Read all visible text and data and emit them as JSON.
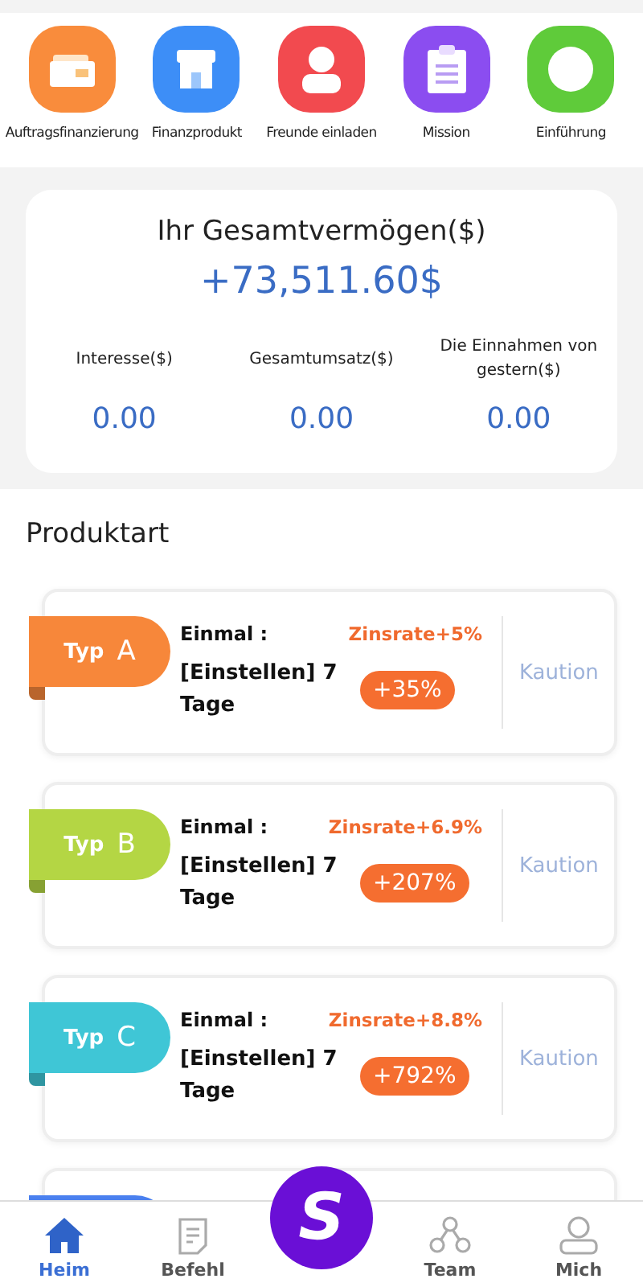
{
  "shortcuts": [
    {
      "label": "Auftragsfinanzierung",
      "color": "#f98c3c",
      "kind": "wallet"
    },
    {
      "label": "Finanzprodukt",
      "color": "#3d8ef7",
      "kind": "shop"
    },
    {
      "label": "Freunde einladen",
      "color": "#f24a4f",
      "kind": "person"
    },
    {
      "label": "Mission",
      "color": "#8b4df0",
      "kind": "clipboard"
    },
    {
      "label": "Einführung",
      "color": "#5fcb3a",
      "kind": "circle"
    }
  ],
  "assets": {
    "title": "Ihr Gesamtvermögen($)",
    "total": "+73,511.60$",
    "stats": [
      {
        "label": "Interesse($)",
        "value": "0.00"
      },
      {
        "label": "Gesamtumsatz($)",
        "value": "0.00"
      },
      {
        "label": "Die Einnahmen von gestern($)",
        "value": "0.00"
      }
    ]
  },
  "section_title": "Produktart",
  "products": [
    {
      "type_word": "Typ",
      "type_letter": "A",
      "color": "#f7873a",
      "frequency": "Einmal :",
      "rate": "Zinsrate+5%",
      "term": "[Einstellen] 7 Tage",
      "return": "+35%",
      "action": "Kaution"
    },
    {
      "type_word": "Typ",
      "type_letter": "B",
      "color": "#b4d644",
      "frequency": "Einmal :",
      "rate": "Zinsrate+6.9%",
      "term": "[Einstellen] 7 Tage",
      "return": "+207%",
      "action": "Kaution"
    },
    {
      "type_word": "Typ",
      "type_letter": "C",
      "color": "#3fc6d6",
      "frequency": "Einmal :",
      "rate": "Zinsrate+8.8%",
      "term": "[Einstellen] 7 Tage",
      "return": "+792%",
      "action": "Kaution"
    }
  ],
  "partial_product": {
    "color": "#4a80ef"
  },
  "nav": [
    {
      "label": "Heim",
      "kind": "home",
      "selected": true
    },
    {
      "label": "Befehl",
      "kind": "doc",
      "selected": false
    },
    {
      "label": "S",
      "kind": "center"
    },
    {
      "label": "Team",
      "kind": "team",
      "selected": false
    },
    {
      "label": "Mich",
      "kind": "user",
      "selected": false
    }
  ]
}
